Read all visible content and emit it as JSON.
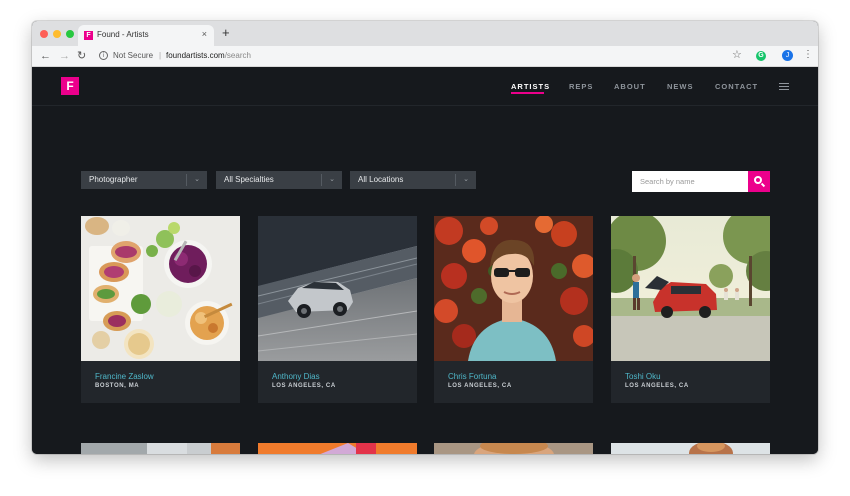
{
  "browser": {
    "tab_title": "Found - Artists",
    "tab_favicon_letter": "F",
    "new_tab_label": "+",
    "close_label": "×",
    "security_label": "Not Secure",
    "separator": "|",
    "url_host": "foundartists.com",
    "url_path": "/search",
    "extension_letter": "G",
    "profile_letter": "J"
  },
  "site": {
    "logo_letter": "F",
    "accent_color": "#ec008c",
    "nav": [
      {
        "label": "ARTISTS",
        "active": true
      },
      {
        "label": "REPS",
        "active": false
      },
      {
        "label": "ABOUT",
        "active": false
      },
      {
        "label": "NEWS",
        "active": false
      },
      {
        "label": "CONTACT",
        "active": false
      }
    ]
  },
  "filters": [
    {
      "selected": "Photographer"
    },
    {
      "selected": "All Specialties"
    },
    {
      "selected": "All Locations"
    }
  ],
  "search": {
    "placeholder": "Search by name"
  },
  "artists": [
    {
      "name": "Francine Zaslow",
      "location": "BOSTON, MA"
    },
    {
      "name": "Anthony Dias",
      "location": "LOS ANGELES, CA"
    },
    {
      "name": "Chris Fortuna",
      "location": "LOS ANGELES, CA"
    },
    {
      "name": "Toshi Oku",
      "location": "LOS ANGELES, CA"
    }
  ]
}
